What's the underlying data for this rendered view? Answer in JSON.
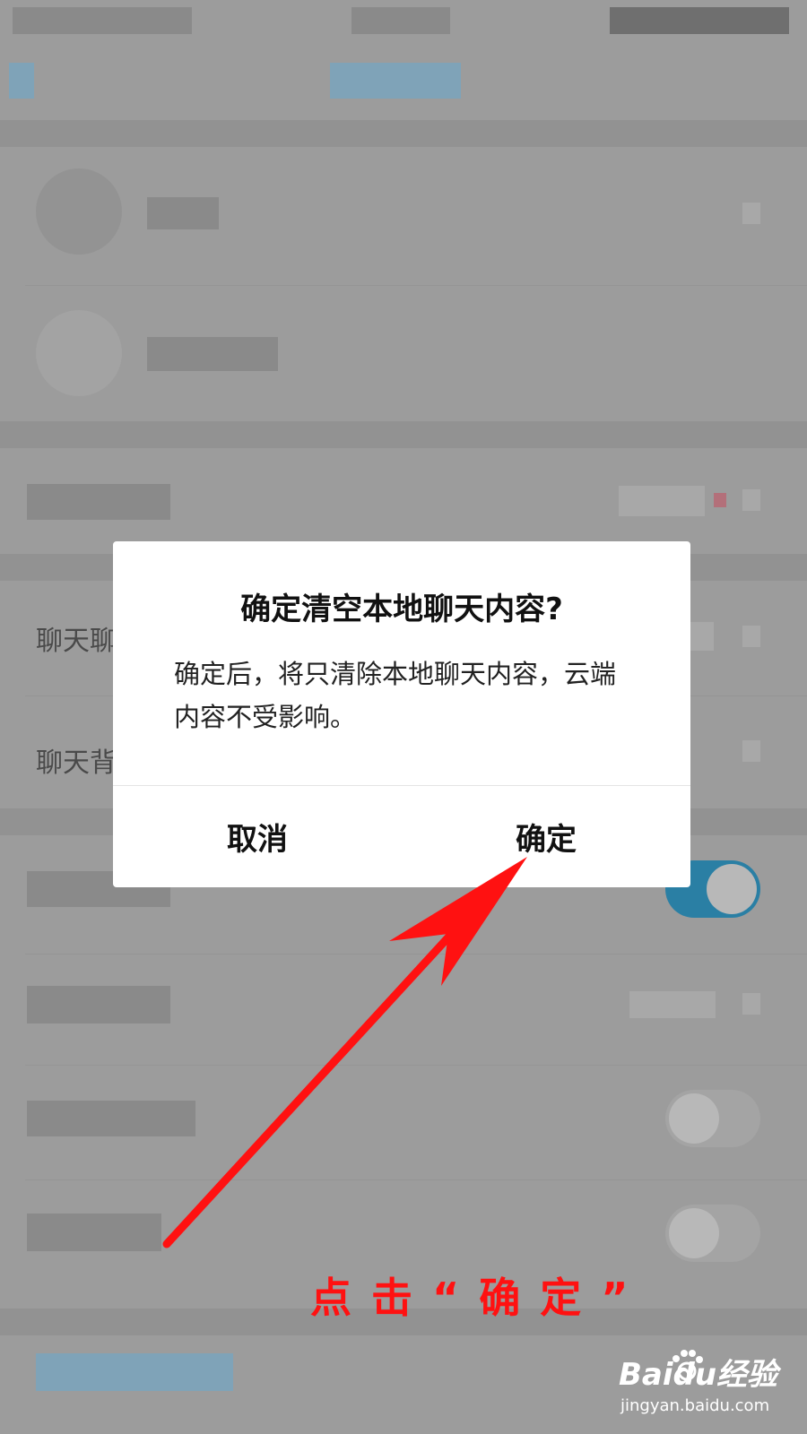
{
  "dialog": {
    "title": "确定清空本地聊天内容?",
    "message": "确定后，将只清除本地聊天内容，云端内容不受影响。",
    "cancel_label": "取消",
    "confirm_label": "确定"
  },
  "background": {
    "partial_labels": [
      "聊天聊",
      "聊天背"
    ]
  },
  "annotation": {
    "text": "点击“确定”",
    "color": "#ff1111"
  },
  "watermark": {
    "logo": "Baidu经验",
    "url": "jingyan.baidu.com"
  },
  "colors": {
    "overlay": "#9c9c9c",
    "toggle_on": "#2a7fa4",
    "arrow": "#ff1111"
  }
}
